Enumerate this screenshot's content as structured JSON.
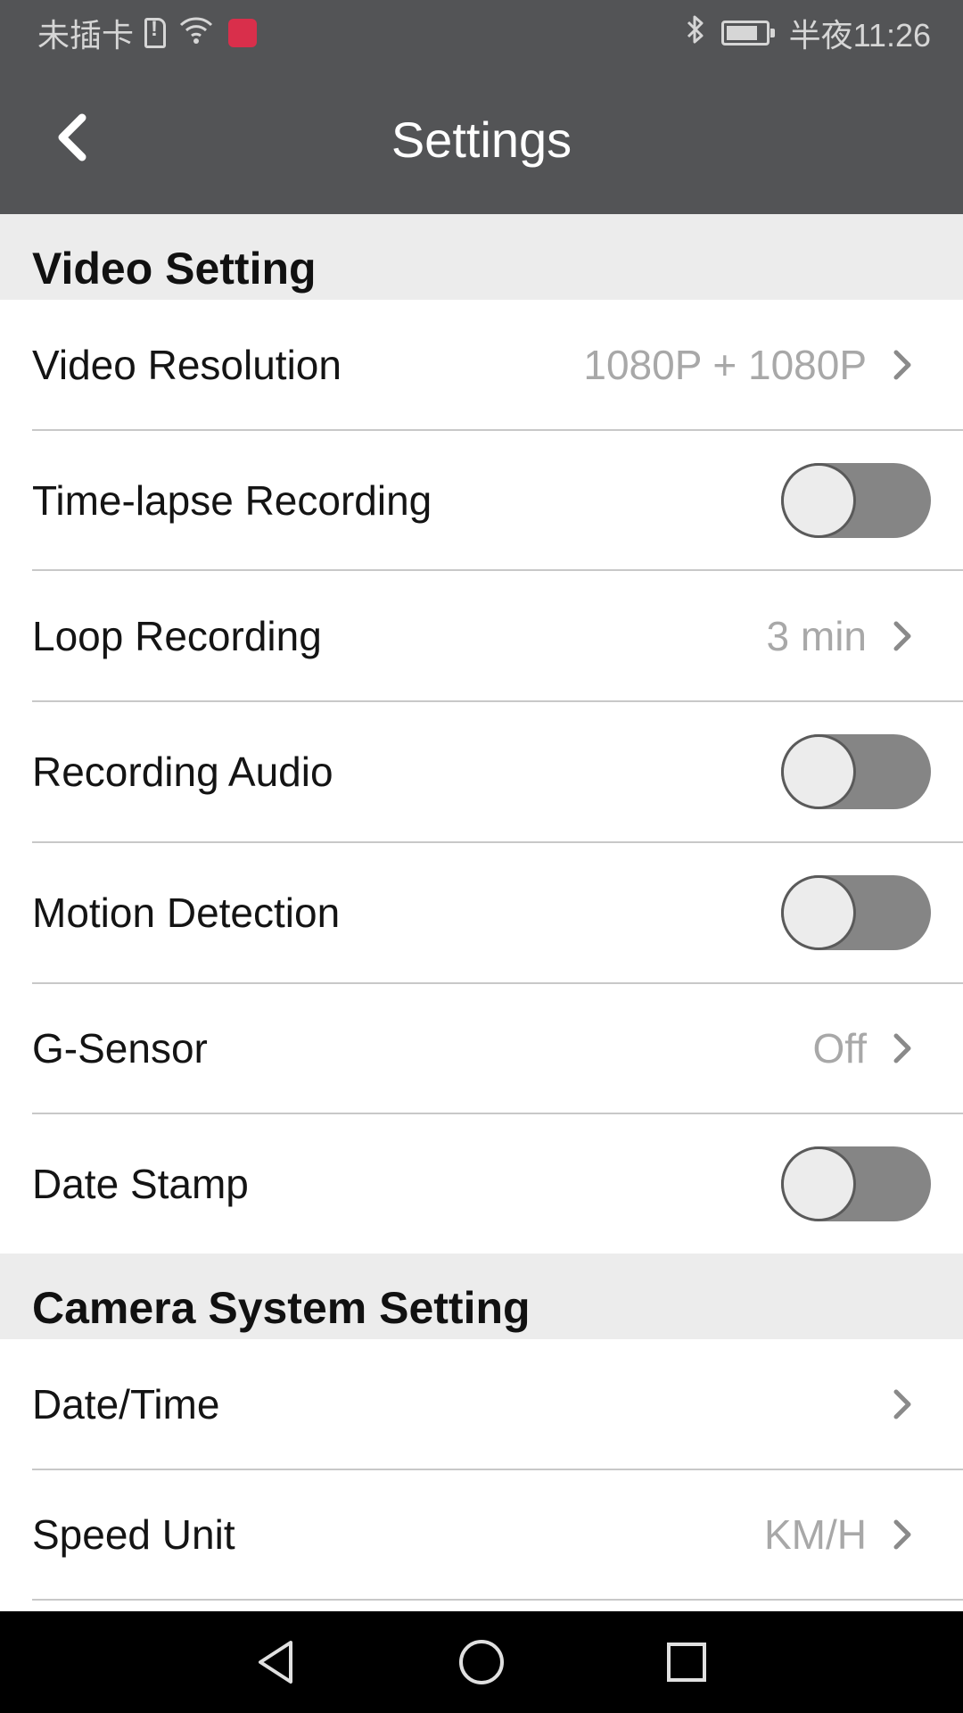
{
  "status_bar": {
    "carrier": "未插卡",
    "time": "半夜11:26"
  },
  "app_bar": {
    "title": "Settings"
  },
  "sections": [
    {
      "header": "Video Setting",
      "rows": [
        {
          "label": "Video Resolution",
          "value": "1080P + 1080P",
          "type": "nav"
        },
        {
          "label": "Time-lapse Recording",
          "type": "toggle",
          "on": false
        },
        {
          "label": "Loop Recording",
          "value": "3 min",
          "type": "nav"
        },
        {
          "label": "Recording Audio",
          "type": "toggle",
          "on": false
        },
        {
          "label": "Motion Detection",
          "type": "toggle",
          "on": false
        },
        {
          "label": "G-Sensor",
          "value": "Off",
          "type": "nav"
        },
        {
          "label": "Date Stamp",
          "type": "toggle",
          "on": false
        }
      ]
    },
    {
      "header": "Camera System Setting",
      "rows": [
        {
          "label": "Date/Time",
          "value": "",
          "type": "nav"
        },
        {
          "label": "Speed Unit",
          "value": "KM/H",
          "type": "nav"
        }
      ]
    }
  ],
  "icons": {
    "back": "chevron-left-icon",
    "row_nav": "chevron-right-icon",
    "nav_back": "triangle-back-icon",
    "nav_home": "circle-home-icon",
    "nav_recents": "square-recents-icon"
  },
  "colors": {
    "app_bar": "#535456",
    "section_bg": "#ececec",
    "toggle_off_track": "#858585",
    "value_text": "#a8a8a8"
  }
}
